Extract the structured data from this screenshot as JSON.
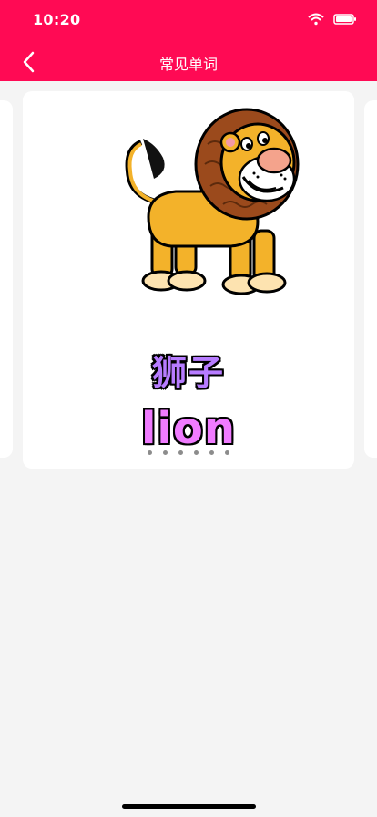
{
  "status": {
    "time": "10:20"
  },
  "nav": {
    "title": "常见单词"
  },
  "card": {
    "word_cn": "狮子",
    "word_en": "lion"
  },
  "pagination": {
    "dot_count": 6,
    "active_index": 2
  },
  "colors": {
    "header": "#ff0a54",
    "background": "#f4f4f4",
    "card": "#ffffff",
    "word_cn": "#b77cff",
    "word_en": "#f07bff"
  },
  "icons": {
    "back": "chevron-left-icon",
    "wifi": "wifi-icon",
    "battery": "battery-icon"
  }
}
